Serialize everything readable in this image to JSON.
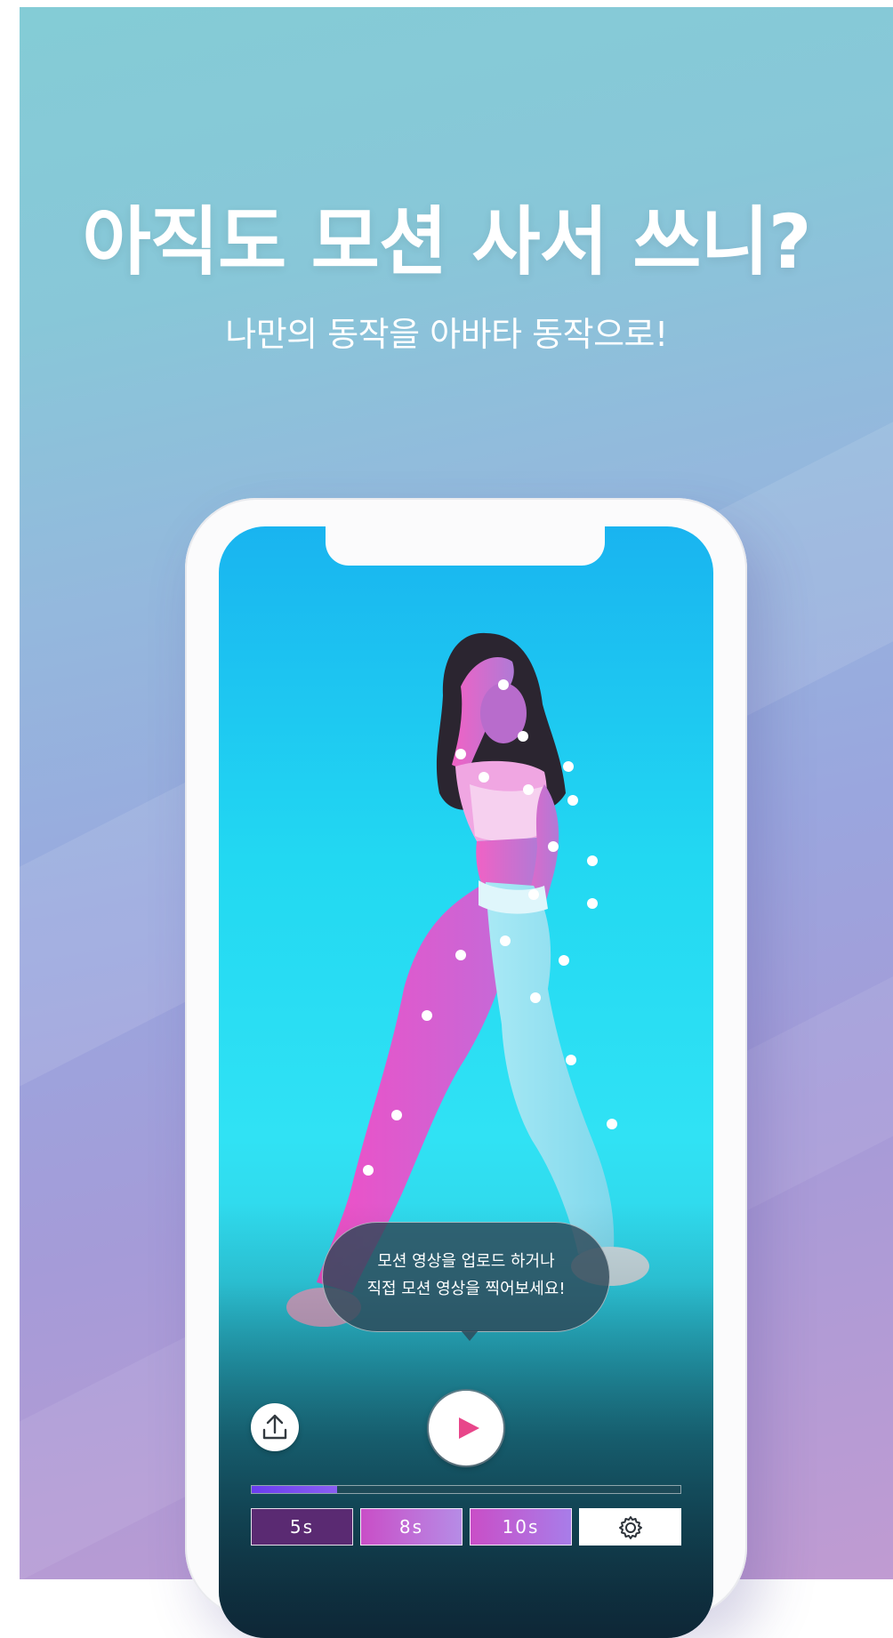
{
  "hero": {
    "headline": "아직도 모션 사서 쓰니?",
    "subline": "나만의 동작을 아바타 동작으로!"
  },
  "phone": {
    "tooltip": {
      "line1": "모션 영상을 업로드 하거나",
      "line2": "직접 모션 영상을 찍어보세요!"
    },
    "controls": {
      "upload_icon": "upload-icon",
      "play_icon": "play-icon",
      "settings_icon": "gear-icon",
      "progress": 0.2,
      "durations": [
        "5s",
        "8s",
        "10s"
      ],
      "selected_duration": "5s"
    }
  },
  "colors": {
    "accent_pink": "#e8468a",
    "progress_purple": "#6a3df0",
    "selected_duration": "#5a2a72"
  }
}
